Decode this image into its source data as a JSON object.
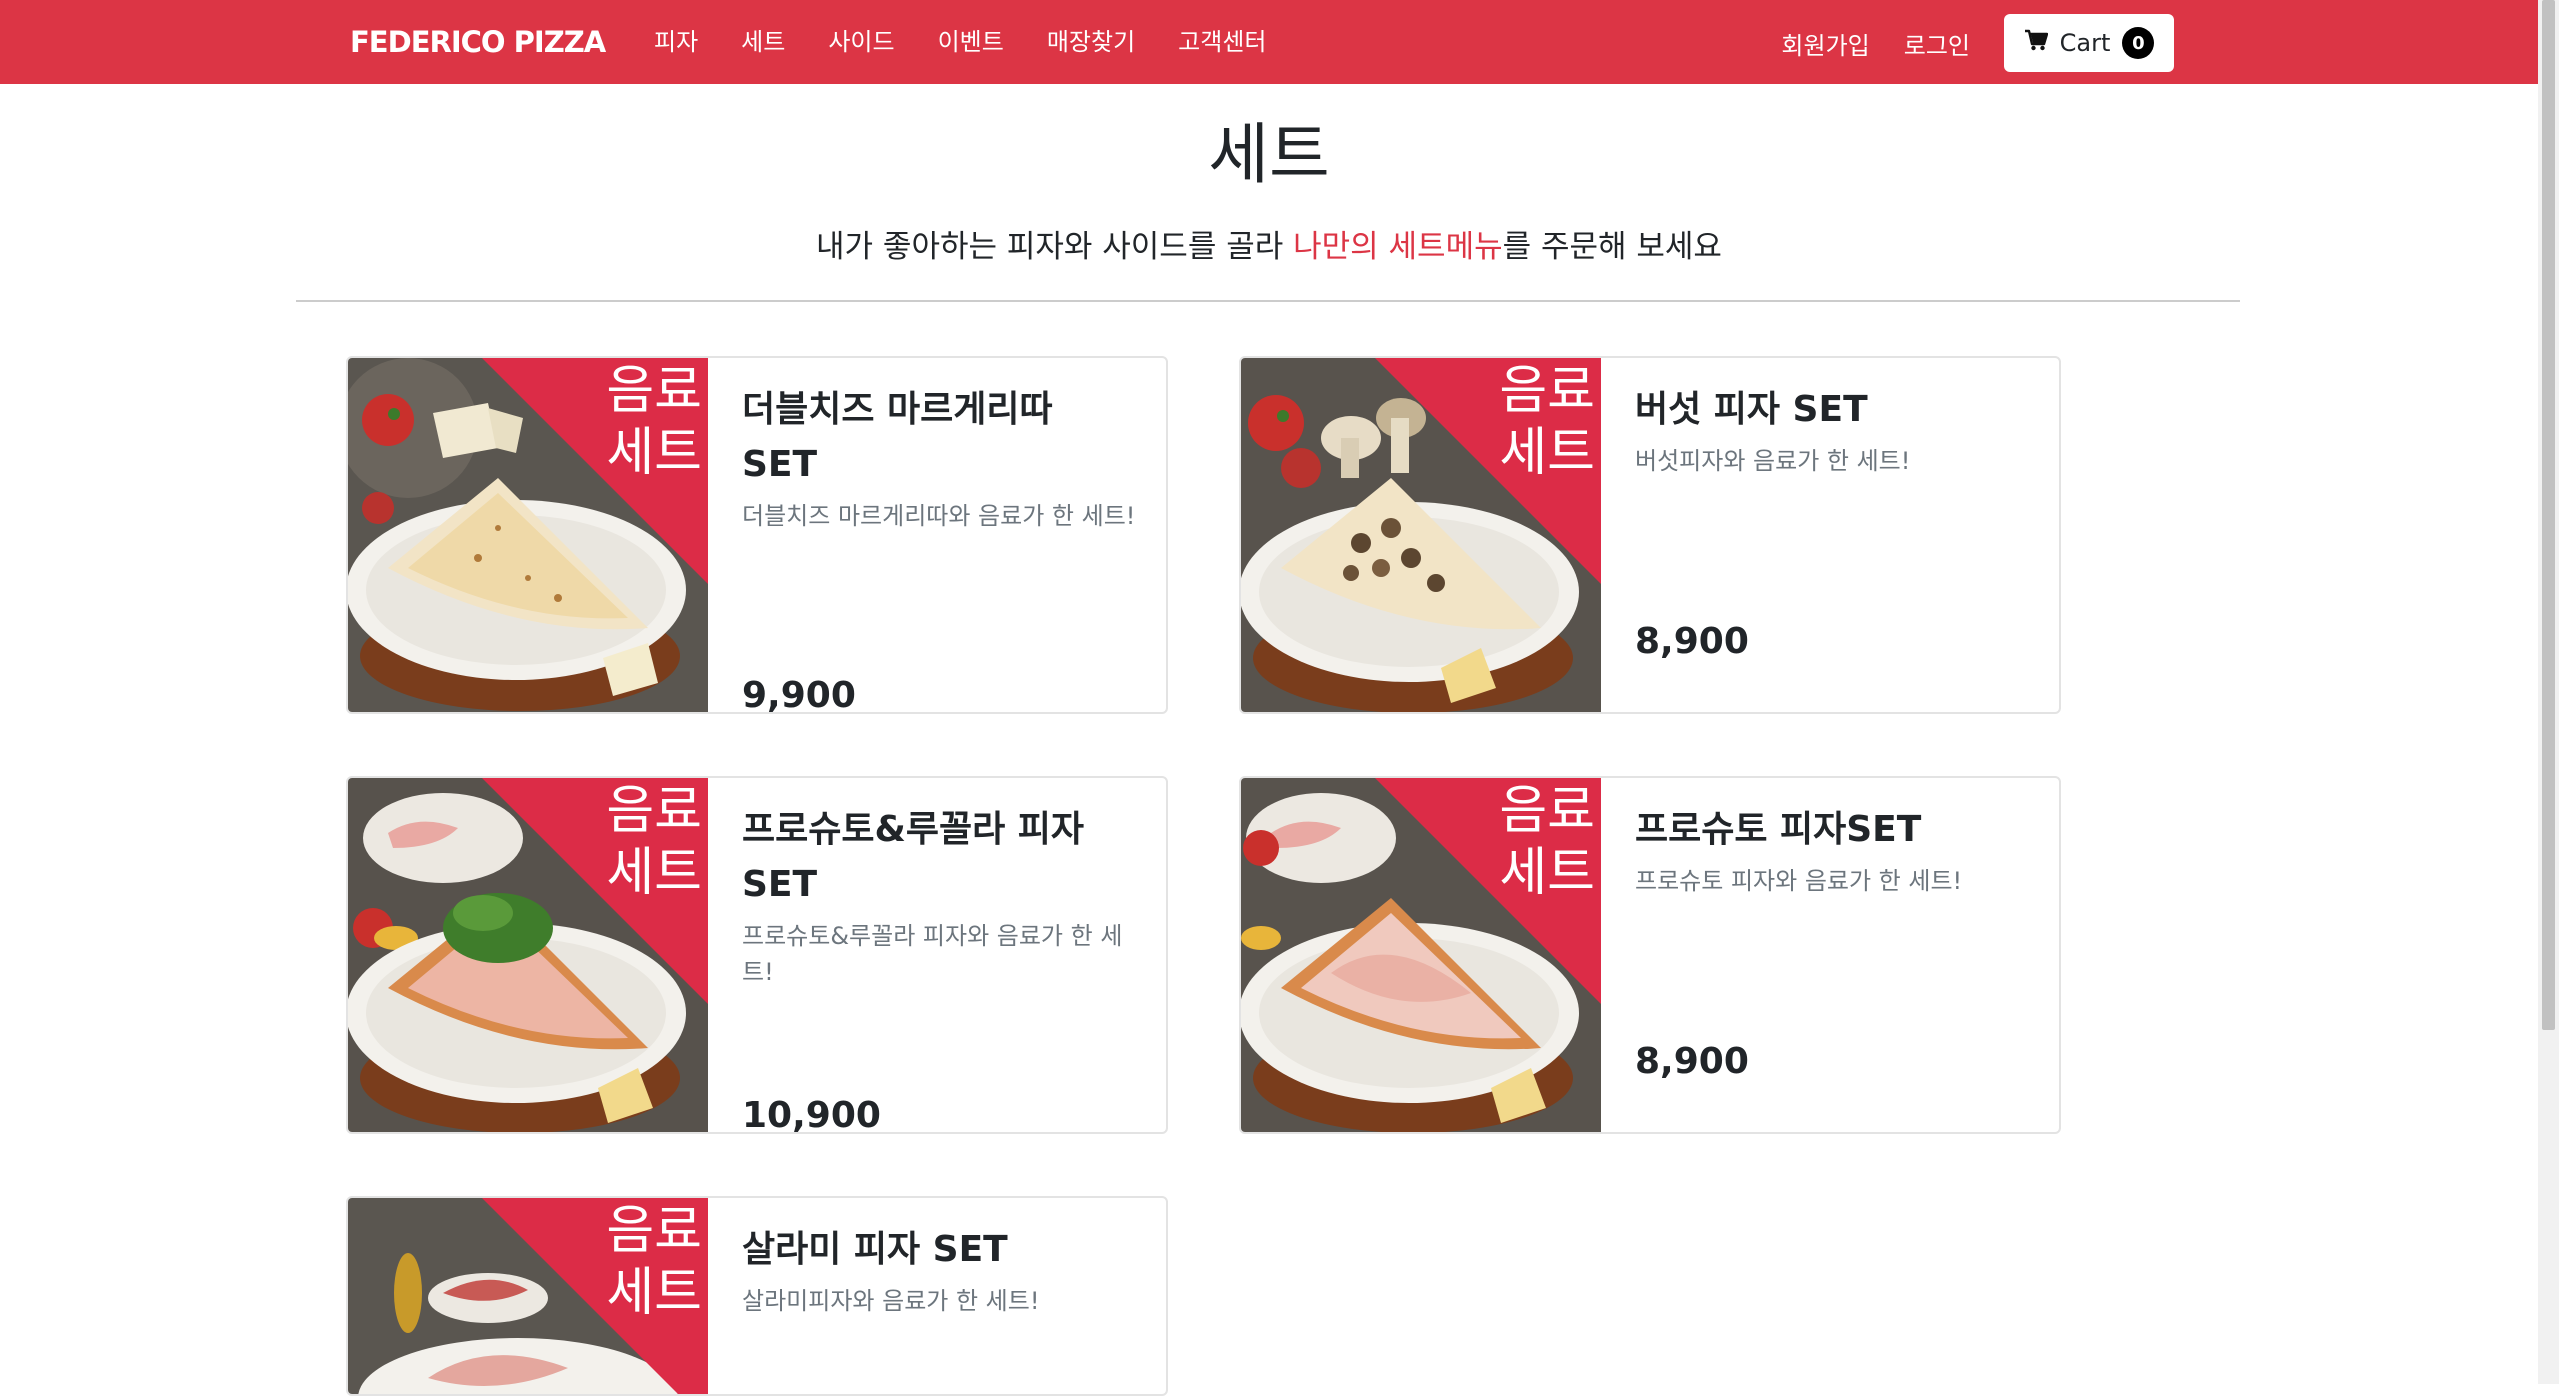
{
  "navbar": {
    "brand": "FEDERICO PIZZA",
    "links": [
      "피자",
      "세트",
      "사이드",
      "이벤트",
      "매장찾기",
      "고객센터"
    ],
    "signup": "회원가입",
    "login": "로그인",
    "cart_label": "Cart",
    "cart_count": "0",
    "brand_color": "#dc3545"
  },
  "header": {
    "title": "세트",
    "subtitle_before": "내가 좋아하는 피자와 사이드를 골라 ",
    "subtitle_highlight": "나만의 세트메뉴",
    "subtitle_after": "를 주문해 보세요"
  },
  "banner_label_line1": "음료",
  "banner_label_line2": "세트",
  "products": [
    {
      "name": "더블치즈 마르게리따 SET",
      "desc": "더블치즈 마르게리따와 음료가 한 세트!",
      "price": "9,900"
    },
    {
      "name": "버섯 피자 SET",
      "desc": "버섯피자와 음료가 한 세트!",
      "price": "8,900"
    },
    {
      "name": "프로슈토&루꼴라 피자 SET",
      "desc": "프로슈토&루꼴라 피자와 음료가 한 세트!",
      "price": "10,900"
    },
    {
      "name": "프로슈토 피자SET",
      "desc": "프로슈토 피자와 음료가 한 세트!",
      "price": "8,900"
    },
    {
      "name": "살라미 피자 SET",
      "desc": "살라미피자와 음료가 한 세트!",
      "price": ""
    }
  ]
}
